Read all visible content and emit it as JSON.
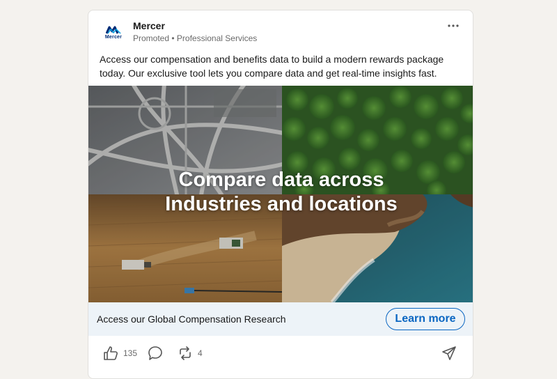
{
  "post": {
    "company": "Mercer",
    "logo_text": "Mercer",
    "meta": "Promoted • Professional Services",
    "body": "Access our compensation and benefits data to build a modern rewards package today. Our exclusive tool lets you compare data and get real-time insights fast.",
    "image_headline_line1": "Compare data across",
    "image_headline_line2": "Industries and locations",
    "cta_title": "Access our Global Compensation Research",
    "cta_button": "Learn more",
    "like_count": "135",
    "repost_count": "4",
    "icons": {
      "more": "more-options-icon",
      "like": "thumbs-up-icon",
      "comment": "comment-icon",
      "repost": "repost-icon",
      "send": "send-icon"
    }
  },
  "colors": {
    "page_bg": "#f4f2ee",
    "card_bg": "#ffffff",
    "cta_bar_bg": "#edf3f8",
    "link_blue": "#0a66c2",
    "brand_navy": "#002c77"
  }
}
